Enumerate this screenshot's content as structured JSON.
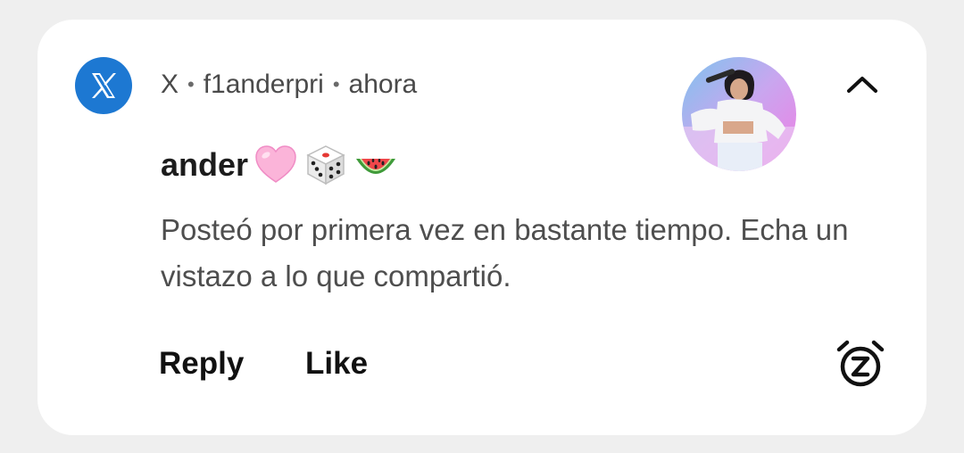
{
  "notification": {
    "app_name": "X",
    "account": "f1anderpri",
    "time": "ahora",
    "separator": "•",
    "title": "ander",
    "title_emojis": [
      "pink-heart-icon",
      "dice-icon",
      "watermelon-icon"
    ],
    "body": "Posteó por primera vez en bastante tiempo. Echa un vistazo a lo que compartió.",
    "actions": {
      "reply": "Reply",
      "like": "Like"
    },
    "icons": {
      "app": "x-logo-icon",
      "collapse": "chevron-up-icon",
      "snooze": "snooze-alarm-icon"
    }
  },
  "colors": {
    "background": "#efefef",
    "card": "#ffffff",
    "x_brand": "#1d78d2",
    "header_text": "#4a4a4a",
    "body_text": "#4e4e4e",
    "title_text": "#1c1c1c"
  }
}
